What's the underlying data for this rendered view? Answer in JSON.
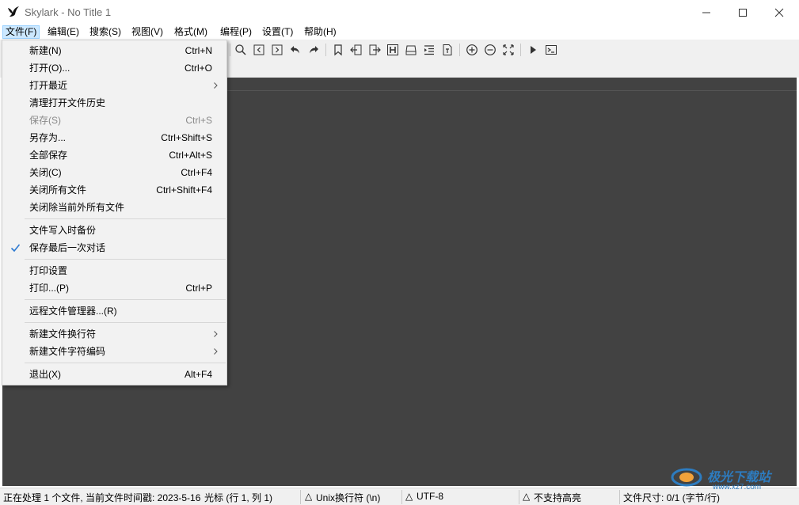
{
  "window": {
    "title": "Skylark - No Title 1"
  },
  "menubar": {
    "items": [
      {
        "label": "文件(F)",
        "active": true
      },
      {
        "label": "编辑(E)"
      },
      {
        "label": "搜索(S)"
      },
      {
        "label": "视图(V)"
      },
      {
        "label": "格式(M)"
      },
      {
        "label": "编程(P)"
      },
      {
        "label": "设置(T)"
      },
      {
        "label": "帮助(H)"
      }
    ]
  },
  "toolbar": {
    "icons": [
      "search-icon",
      "prev-icon",
      "next-icon",
      "undo-icon",
      "redo-icon",
      "bookmark-icon",
      "import-icon",
      "export-icon",
      "header-icon",
      "drive-icon",
      "indent-icon",
      "file-text-icon",
      "zoom-in-icon",
      "zoom-out-icon",
      "fullscreen-icon",
      "run-icon",
      "terminal-icon"
    ]
  },
  "file_menu": {
    "items": [
      {
        "label": "新建(N)",
        "shortcut": "Ctrl+N"
      },
      {
        "label": "打开(O)...",
        "shortcut": "Ctrl+O"
      },
      {
        "label": "打开最近",
        "shortcut": "",
        "submenu": true
      },
      {
        "label": "清理打开文件历史",
        "shortcut": ""
      },
      {
        "label": "保存(S)",
        "shortcut": "Ctrl+S",
        "disabled": true
      },
      {
        "label": "另存为...",
        "shortcut": "Ctrl+Shift+S"
      },
      {
        "label": "全部保存",
        "shortcut": "Ctrl+Alt+S"
      },
      {
        "label": "关闭(C)",
        "shortcut": "Ctrl+F4"
      },
      {
        "label": "关闭所有文件",
        "shortcut": "Ctrl+Shift+F4"
      },
      {
        "label": "关闭除当前外所有文件",
        "shortcut": ""
      },
      {
        "label": "文件写入时备份",
        "shortcut": ""
      },
      {
        "label": "保存最后一次对话",
        "shortcut": "",
        "checked": true
      },
      {
        "label": "打印设置",
        "shortcut": ""
      },
      {
        "label": "打印...(P)",
        "shortcut": "Ctrl+P"
      },
      {
        "label": "远程文件管理器...(R)",
        "shortcut": ""
      },
      {
        "label": "新建文件换行符",
        "shortcut": "",
        "submenu": true
      },
      {
        "label": "新建文件字符编码",
        "shortcut": "",
        "submenu": true
      },
      {
        "label": "退出(X)",
        "shortcut": "Alt+F4"
      }
    ]
  },
  "statusbar": {
    "processing": "正在处理 1 个文件, 当前文件时间戳: 2023-5-16",
    "cursor": "光标 (行 1, 列 1)",
    "line_ending": "Unix换行符 (\\n)",
    "encoding": "UTF-8",
    "highlight": "不支持高亮",
    "file_size": "文件尺寸: 0/1 (字节/行)"
  },
  "watermark": {
    "text": "极光下载站",
    "sub": "www.xz7.com"
  },
  "colors": {
    "editor_bg": "#424242",
    "menu_active_bg": "#cce8ff",
    "check": "#2e7ad1"
  }
}
